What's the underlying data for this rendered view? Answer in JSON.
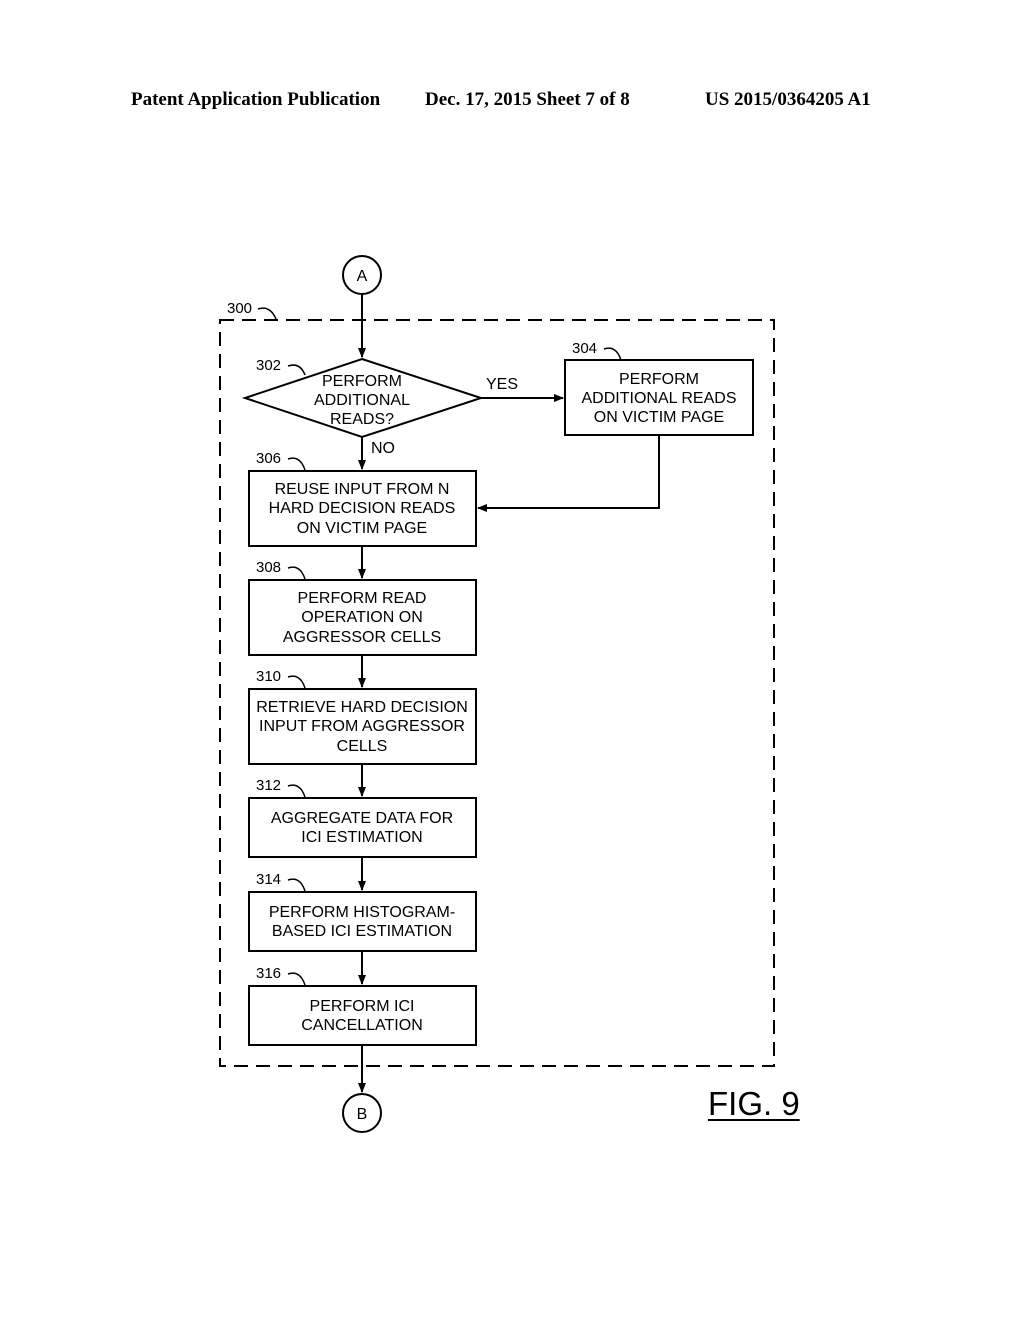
{
  "header": {
    "publication": "Patent Application Publication",
    "date_sheet": "Dec. 17, 2015   Sheet 7 of 8",
    "number": "US 2015/0364205 A1"
  },
  "figure": {
    "label": "FIG. 9"
  },
  "connectors": {
    "start": "A",
    "end": "B"
  },
  "group": {
    "ref": "300"
  },
  "nodes": {
    "n302": {
      "ref": "302",
      "type": "decision",
      "lines": [
        "PERFORM",
        "ADDITIONAL",
        "READS?"
      ]
    },
    "n304": {
      "ref": "304",
      "type": "process",
      "lines": [
        "PERFORM",
        "ADDITIONAL READS",
        "ON VICTIM PAGE"
      ]
    },
    "n306": {
      "ref": "306",
      "type": "process",
      "lines": [
        "REUSE INPUT FROM N",
        "HARD DECISION READS",
        "ON VICTIM PAGE"
      ]
    },
    "n308": {
      "ref": "308",
      "type": "process",
      "lines": [
        "PERFORM READ",
        "OPERATION ON",
        "AGGRESSOR CELLS"
      ]
    },
    "n310": {
      "ref": "310",
      "type": "process",
      "lines": [
        "RETRIEVE HARD DECISION",
        "INPUT FROM AGGRESSOR",
        "CELLS"
      ]
    },
    "n312": {
      "ref": "312",
      "type": "process",
      "lines": [
        "AGGREGATE DATA FOR",
        "ICI ESTIMATION"
      ]
    },
    "n314": {
      "ref": "314",
      "type": "process",
      "lines": [
        "PERFORM HISTOGRAM-",
        "BASED ICI ESTIMATION"
      ]
    },
    "n316": {
      "ref": "316",
      "type": "process",
      "lines": [
        "PERFORM ICI",
        "CANCELLATION"
      ]
    }
  },
  "edge_labels": {
    "yes": "YES",
    "no": "NO"
  }
}
